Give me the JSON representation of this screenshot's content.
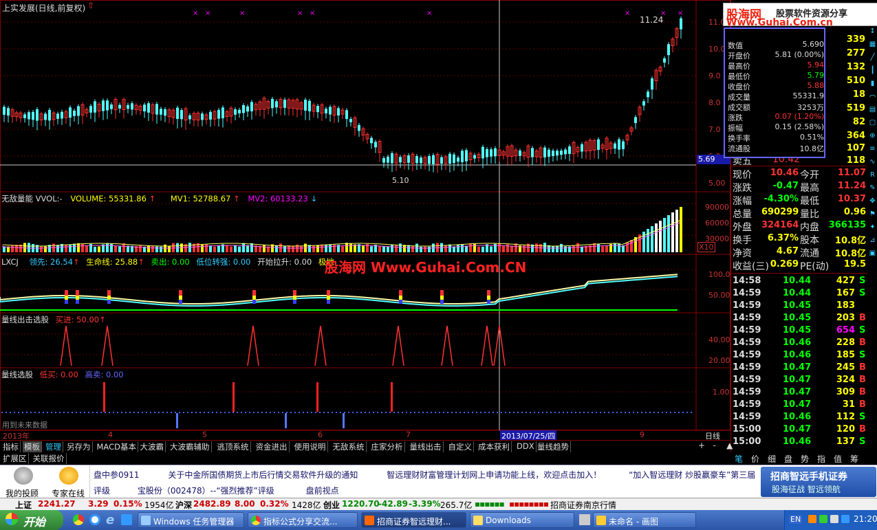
{
  "main_chart": {
    "title": "上实发展(日线,前复权)",
    "price_labels": [
      "11.0",
      "10.0",
      "9.0",
      "8.0",
      "7.0",
      "6.0",
      "5.00"
    ],
    "high_label": "11.24",
    "low_label": "5.10",
    "current_price_tag": "5.69"
  },
  "volume_panel": {
    "title": "无敌量能 VVOL:-",
    "volume": "VOLUME: 55331.86",
    "mv1": "MV1: 52788.67",
    "mv2": "MV2: 60133.23",
    "axis": [
      "90000",
      "60000",
      "30000"
    ],
    "scale": "X10"
  },
  "lxcj_panel": {
    "name": "LXCJ",
    "lead": "领先: 26.54",
    "life": "生命线: 25.88",
    "sell": "卖出: 0.00",
    "low_strong": "低位转强: 0.00",
    "start_rise": "开始拉升: 0.00",
    "bottom": "极地",
    "watermark": "股海网 Www.Guhai.Com.CN",
    "axis": [
      "100.0",
      "50.00"
    ]
  },
  "qxcj_panel": {
    "title": "量线出击选股",
    "buy": "买进: 50.00",
    "axis": [
      "40.00",
      "20.00"
    ]
  },
  "qxxg_panel": {
    "title": "量线选股",
    "low_buy": "低买: 0.00",
    "high_sell": "高卖: 0.00",
    "axis": [
      "1.00"
    ],
    "footnote": "用到未来数据"
  },
  "date_axis": {
    "year": "2013年",
    "months": [
      "4",
      "5",
      "6",
      "7",
      "9"
    ],
    "cursor_date": "2013/07/25/四",
    "period": "日线"
  },
  "infobox": {
    "rows": [
      {
        "label": "数值",
        "value": "5.690"
      },
      {
        "label": "开盘价",
        "value": "5.81 (0.00%)"
      },
      {
        "label": "最高价",
        "value": "5.94"
      },
      {
        "label": "最低价",
        "value": "5.79"
      },
      {
        "label": "收盘价",
        "value": "5.88"
      },
      {
        "label": "成交量",
        "value": "55331.9"
      },
      {
        "label": "成交额",
        "value": "3253万"
      },
      {
        "label": "涨跌",
        "value": "0.07 (1.20%)"
      },
      {
        "label": "振幅",
        "value": "0.15 (2.58%)"
      },
      {
        "label": "换手率",
        "value": "0.51%"
      },
      {
        "label": "流通股",
        "value": "10.8亿"
      }
    ]
  },
  "banner": {
    "brand": "股海网",
    "tagline": "股票软件资源分享",
    "url": "Www.Guhai.Com.cn"
  },
  "order_book_right": [
    "339",
    "277",
    "132",
    "510",
    "18",
    "519",
    "82",
    "364",
    "107",
    "118"
  ],
  "order_book_partial": {
    "label": "卖五",
    "value": "10.42"
  },
  "quote": {
    "rows": [
      {
        "l1": "现价",
        "v1": "10.46",
        "l2": "今开",
        "v2": "11.07"
      },
      {
        "l1": "涨跌",
        "v1": "-0.47",
        "l2": "最高",
        "v2": "11.24"
      },
      {
        "l1": "涨幅",
        "v1": "-4.30%",
        "l2": "最低",
        "v2": "10.37"
      },
      {
        "l1": "总量",
        "v1": "690299",
        "l2": "量比",
        "v2": "0.96"
      },
      {
        "l1": "外盘",
        "v1": "324164",
        "l2": "内盘",
        "v2": "366135"
      },
      {
        "l1": "换手",
        "v1": "6.37%",
        "l2": "股本",
        "v2": "10.8亿"
      },
      {
        "l1": "净资",
        "v1": "4.67",
        "l2": "流通",
        "v2": "10.8亿"
      },
      {
        "l1": "收益(三)",
        "v1": "0.269",
        "l2": "PE(动)",
        "v2": "19.5"
      }
    ]
  },
  "ticks": [
    {
      "t": "14:58",
      "p": "10.44",
      "v": "427",
      "s": "S"
    },
    {
      "t": "14:59",
      "p": "10.44",
      "v": "167",
      "s": "S"
    },
    {
      "t": "14:59",
      "p": "10.45",
      "v": "183",
      "s": ""
    },
    {
      "t": "14:59",
      "p": "10.45",
      "v": "203",
      "s": "B"
    },
    {
      "t": "14:59",
      "p": "10.45",
      "v": "654",
      "s": "S"
    },
    {
      "t": "14:59",
      "p": "10.46",
      "v": "228",
      "s": "B"
    },
    {
      "t": "14:59",
      "p": "10.46",
      "v": "185",
      "s": "S"
    },
    {
      "t": "14:59",
      "p": "10.47",
      "v": "245",
      "s": "B"
    },
    {
      "t": "14:59",
      "p": "10.47",
      "v": "324",
      "s": "B"
    },
    {
      "t": "14:59",
      "p": "10.47",
      "v": "309",
      "s": "B"
    },
    {
      "t": "14:59",
      "p": "10.47",
      "v": "31",
      "s": "B"
    },
    {
      "t": "14:59",
      "p": "10.46",
      "v": "112",
      "s": "S"
    },
    {
      "t": "15:00",
      "p": "10.47",
      "v": "120",
      "s": "B"
    },
    {
      "t": "15:00",
      "p": "10.46",
      "v": "137",
      "s": "S"
    }
  ],
  "tabs": [
    "指标",
    "模板",
    "管理",
    "另存为",
    "MACD基本",
    "大波霸",
    "大波霸辅助",
    "逃顶系统",
    "资金进出",
    "使用说明",
    "无敌系统",
    "庄家分析",
    "量线出击",
    "自定义",
    "成本获利",
    "DDX",
    "量线趋势"
  ],
  "tabs2": [
    "扩展区",
    "关联报价"
  ],
  "side_tabs": [
    "笔",
    "价",
    "细",
    "盘",
    "势",
    "指",
    "值",
    "筹"
  ],
  "news": {
    "left1": "我的投顾",
    "left2": "专家在线",
    "line1": [
      "盘中参0911",
      "关于中金所国债期货上市后行情交易软件升级的通知",
      "智远理财财富管理计划网上申请功能上线，欢迎点击加入！",
      "“加入智远理财 炒股赢豪车”第三届"
    ],
    "line2": [
      "评级",
      "宝股份（002478）--“强烈推荐”评级",
      "盘前视点"
    ],
    "ad_title": "招商智远手机证券",
    "ad_sub": "股海征战 智远领航"
  },
  "status": {
    "sh_label": "上证",
    "sh_val": "2241.27",
    "sh_chg": "3.29",
    "sh_pct": "0.15%",
    "sh_amt": "1954亿",
    "hs_label": "沪深",
    "hs_val": "2482.89",
    "hs_chg": "8.00",
    "hs_pct": "0.32%",
    "hs_amt": "1428亿",
    "cy_label": "创业",
    "cy_val": "1220.70",
    "cy_chg": "-42.89",
    "cy_pct": "-3.39%",
    "cy_amt": "265.7亿",
    "broker": "招商证券南京行情"
  },
  "taskbar": {
    "start": "开始",
    "items": [
      "Windows 任务管理器",
      "指标公式分享交流...",
      "招商证券智远理财...",
      "Downloads",
      "未命名 - 画图"
    ],
    "lang": "EN",
    "clock": "21:20"
  },
  "colors": {
    "up": "#ff3232",
    "down": "#54ffff",
    "yellow": "#ffff00",
    "green": "#00ff00",
    "magenta": "#ff00ff"
  }
}
